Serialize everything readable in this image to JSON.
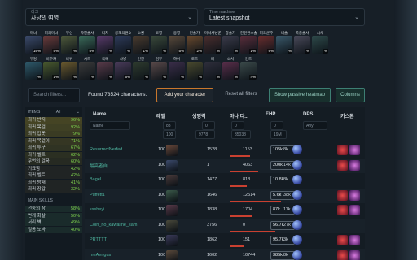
{
  "league": {
    "label": "리그",
    "value": "사냥의 여명"
  },
  "timemachine": {
    "label": "Time machine",
    "value": "Latest snapshot"
  },
  "classes_row1": [
    {
      "name": "마녀",
      "pct": "16%",
      "color": "#3b4a6b"
    },
    {
      "name": "피의마녀",
      "pct": "5%",
      "color": "#6b3b3b"
    },
    {
      "name": "무신",
      "pct": "%",
      "color": "#4f5a3b"
    },
    {
      "name": "자연술사",
      "pct": "5%",
      "color": "#3b6b5a"
    },
    {
      "name": "리치",
      "pct": "%",
      "color": "#5a3b6b"
    },
    {
      "name": "공포의원소술사",
      "pct": "%",
      "color": "#2e3b5a"
    },
    {
      "name": "소환",
      "pct": "1%",
      "color": "#4a3b2e"
    },
    {
      "name": "모병",
      "pct": "%",
      "color": "#3b4a3b"
    },
    {
      "name": "용병",
      "pct": "5%",
      "color": "#5a4a3b"
    },
    {
      "name": "전술가",
      "pct": "2%",
      "color": "#6b4a2e"
    },
    {
      "name": "마녀사냥꾼",
      "pct": "%",
      "color": "#4a2e2e"
    },
    {
      "name": "창술가",
      "pct": "%",
      "color": "#3b3b4a"
    },
    {
      "name": "한딘원소술",
      "pct": "1%",
      "color": "#5a2e3b"
    },
    {
      "name": "피의군주",
      "pct": "9%",
      "color": "#6b2e2e"
    },
    {
      "name": "비술",
      "pct": "%",
      "color": "#3b5a6b"
    },
    {
      "name": "폭풍술사",
      "pct": "%",
      "color": "#4a4a5a"
    },
    {
      "name": "시체",
      "pct": "%",
      "color": "#2e4a4a"
    }
  ],
  "classes_row2": [
    {
      "name": "무당",
      "pct": "%",
      "color": "#2e5a6b"
    },
    {
      "name": "바주카",
      "pct": "1%",
      "color": "#4a5a2e"
    },
    {
      "name": "바위",
      "pct": "%",
      "color": "#6b5a2e"
    },
    {
      "name": "시트",
      "pct": "%",
      "color": "#3b3b3b"
    },
    {
      "name": "곡예",
      "pct": "%",
      "color": "#5a3b4a"
    },
    {
      "name": "사냥",
      "pct": "6%",
      "color": "#4a3b5a"
    },
    {
      "name": "인간",
      "pct": "%",
      "color": "#2e3b2e"
    },
    {
      "name": "검무",
      "pct": "%",
      "color": "#5a4a4a"
    },
    {
      "name": "하이",
      "pct": "%",
      "color": "#3b2e4a"
    },
    {
      "name": "로드",
      "pct": "%",
      "color": "#4a4a2e"
    },
    {
      "name": "배",
      "pct": "%",
      "color": "#2e2e3b"
    },
    {
      "name": "소서",
      "pct": "%",
      "color": "#5a2e4a"
    },
    {
      "name": "인트",
      "pct": "4%",
      "color": "#3b4a4a"
    }
  ],
  "search": {
    "placeholder": "Search filters..."
  },
  "found_text": "Found 73524 characters.",
  "buttons": {
    "add": "Add your character",
    "reset": "Reset all filters",
    "heatmap": "Show passive heatmap",
    "columns": "Columns"
  },
  "sidebar": {
    "items_label": "ITEMS",
    "items_filter": "All",
    "items": [
      {
        "label": "최귀 반지",
        "pct": "96%"
      },
      {
        "label": "최귀 목걸",
        "pct": "92%"
      },
      {
        "label": "최귀 갑옷",
        "pct": "79%"
      },
      {
        "label": "최귀 목걸이",
        "pct": "71%"
      },
      {
        "label": "최귀 투구",
        "pct": "67%"
      },
      {
        "label": "최귀 벨트",
        "pct": "62%"
      },
      {
        "label": "무언의 걸음",
        "pct": "60%"
      },
      {
        "label": "기묘함",
        "pct": "42%"
      },
      {
        "label": "최귀 벨트",
        "pct": "42%"
      },
      {
        "label": "최귀 방패",
        "pct": "41%"
      },
      {
        "label": "최귀 장갑",
        "pct": "32%"
      }
    ],
    "skills_label": "MAIN SKILLS",
    "skills": [
      {
        "label": "천둥의 창",
        "pct": "58%"
      },
      {
        "label": "번개 화살",
        "pct": "50%"
      },
      {
        "label": "서리 벽",
        "pct": "49%"
      },
      {
        "label": "얼음 노바",
        "pct": "40%"
      }
    ]
  },
  "columns": {
    "name": "Name",
    "level": "레벨",
    "life": "생명력",
    "mana": "마나 다...",
    "ehp": "EHP",
    "dps": "DPS",
    "skill": "키스톤"
  },
  "filters": {
    "name": "Name",
    "level": "83",
    "life": "0",
    "mana": "0",
    "ehp": "0",
    "dps": "Any",
    "lvl_max": "100",
    "life_max": "9778",
    "mana_max": "35038",
    "ehp_max": "19M"
  },
  "rows": [
    {
      "name": "ResurrectNerfed",
      "level": "100",
      "life": "1528",
      "mana": "1153",
      "ehp": "8k",
      "dps": "105k",
      "color": "#6b4a3b",
      "ehp_frac": 0.35
    },
    {
      "name": "最高者自",
      "level": "100",
      "life": "1",
      "mana": "4063",
      "ehp": "14k",
      "dps": "200k",
      "color": "#3b4a6b",
      "ehp_frac": 0.5
    },
    {
      "name": "Bagel",
      "level": "100",
      "life": "1477",
      "mana": "818",
      "ehp": "8k",
      "dps": "10.8k",
      "color": "#4a3b3b",
      "ehp_frac": 0.3
    },
    {
      "name": "Puffett1",
      "level": "100",
      "life": "1646",
      "mana": "12514",
      "ehp": "38k",
      "dps": "5.6k",
      "color": "#3b5a4a",
      "ehp_frac": 0.9
    },
    {
      "name": "sssheyi",
      "level": "100",
      "life": "1838",
      "mana": "1704",
      "ehp": "11k",
      "dps": "87k",
      "color": "#5a3b4a",
      "ehp_frac": 0.4
    },
    {
      "name": "Coin_no_kawaiine_sam",
      "level": "100",
      "life": "3756",
      "mana": "0",
      "ehp": "27k",
      "dps": "56.7k",
      "color": "#4a4a3b",
      "ehp_frac": 0.8
    },
    {
      "name": "PRTTTT",
      "level": "100",
      "life": "1862",
      "mana": "151",
      "ehp": "3k",
      "dps": "95.7k",
      "color": "#3b3b5a",
      "ehp_frac": 0.25
    },
    {
      "name": "meAengus",
      "level": "100",
      "life": "1602",
      "mana": "10744",
      "ehp": "8k",
      "dps": "385k",
      "color": "#5a4a3b",
      "ehp_frac": 0.55
    }
  ]
}
